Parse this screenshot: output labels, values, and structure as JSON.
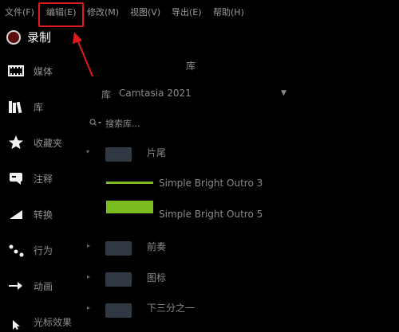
{
  "menu": {
    "items": [
      {
        "label": "文件(F)"
      },
      {
        "label": "编辑(E)"
      },
      {
        "label": "修改(M)"
      },
      {
        "label": "视图(V)"
      },
      {
        "label": "导出(E)"
      },
      {
        "label": "帮助(H)"
      }
    ]
  },
  "record": {
    "label": "录制"
  },
  "nav": {
    "items": [
      {
        "label": "媒体",
        "icon": "film-strip-icon"
      },
      {
        "label": "库",
        "icon": "library-books-icon"
      },
      {
        "label": "收藏夹",
        "icon": "star-icon"
      },
      {
        "label": "注释",
        "icon": "speech-bubble-icon"
      },
      {
        "label": "转换",
        "icon": "transition-ramp-icon"
      },
      {
        "label": "行为",
        "icon": "dots-behavior-icon"
      },
      {
        "label": "动画",
        "icon": "arrow-animation-icon"
      },
      {
        "label": "光标效果",
        "icon": "cursor-icon"
      }
    ]
  },
  "library": {
    "title": "库",
    "select_label": "库",
    "select_value": "Camtasia 2021",
    "search_placeholder": "搜索库...",
    "items": [
      {
        "label": "片尾"
      },
      {
        "label": "Simple Bright Outro 3"
      },
      {
        "label": "Simple Bright Outro 5"
      },
      {
        "label": "前奏"
      },
      {
        "label": "图标"
      },
      {
        "label": "下三分之一"
      }
    ]
  },
  "colors": {
    "highlight": "#e0191f",
    "thumb_green": "#7bbd1f",
    "record_dot": "#5a0c0c"
  }
}
